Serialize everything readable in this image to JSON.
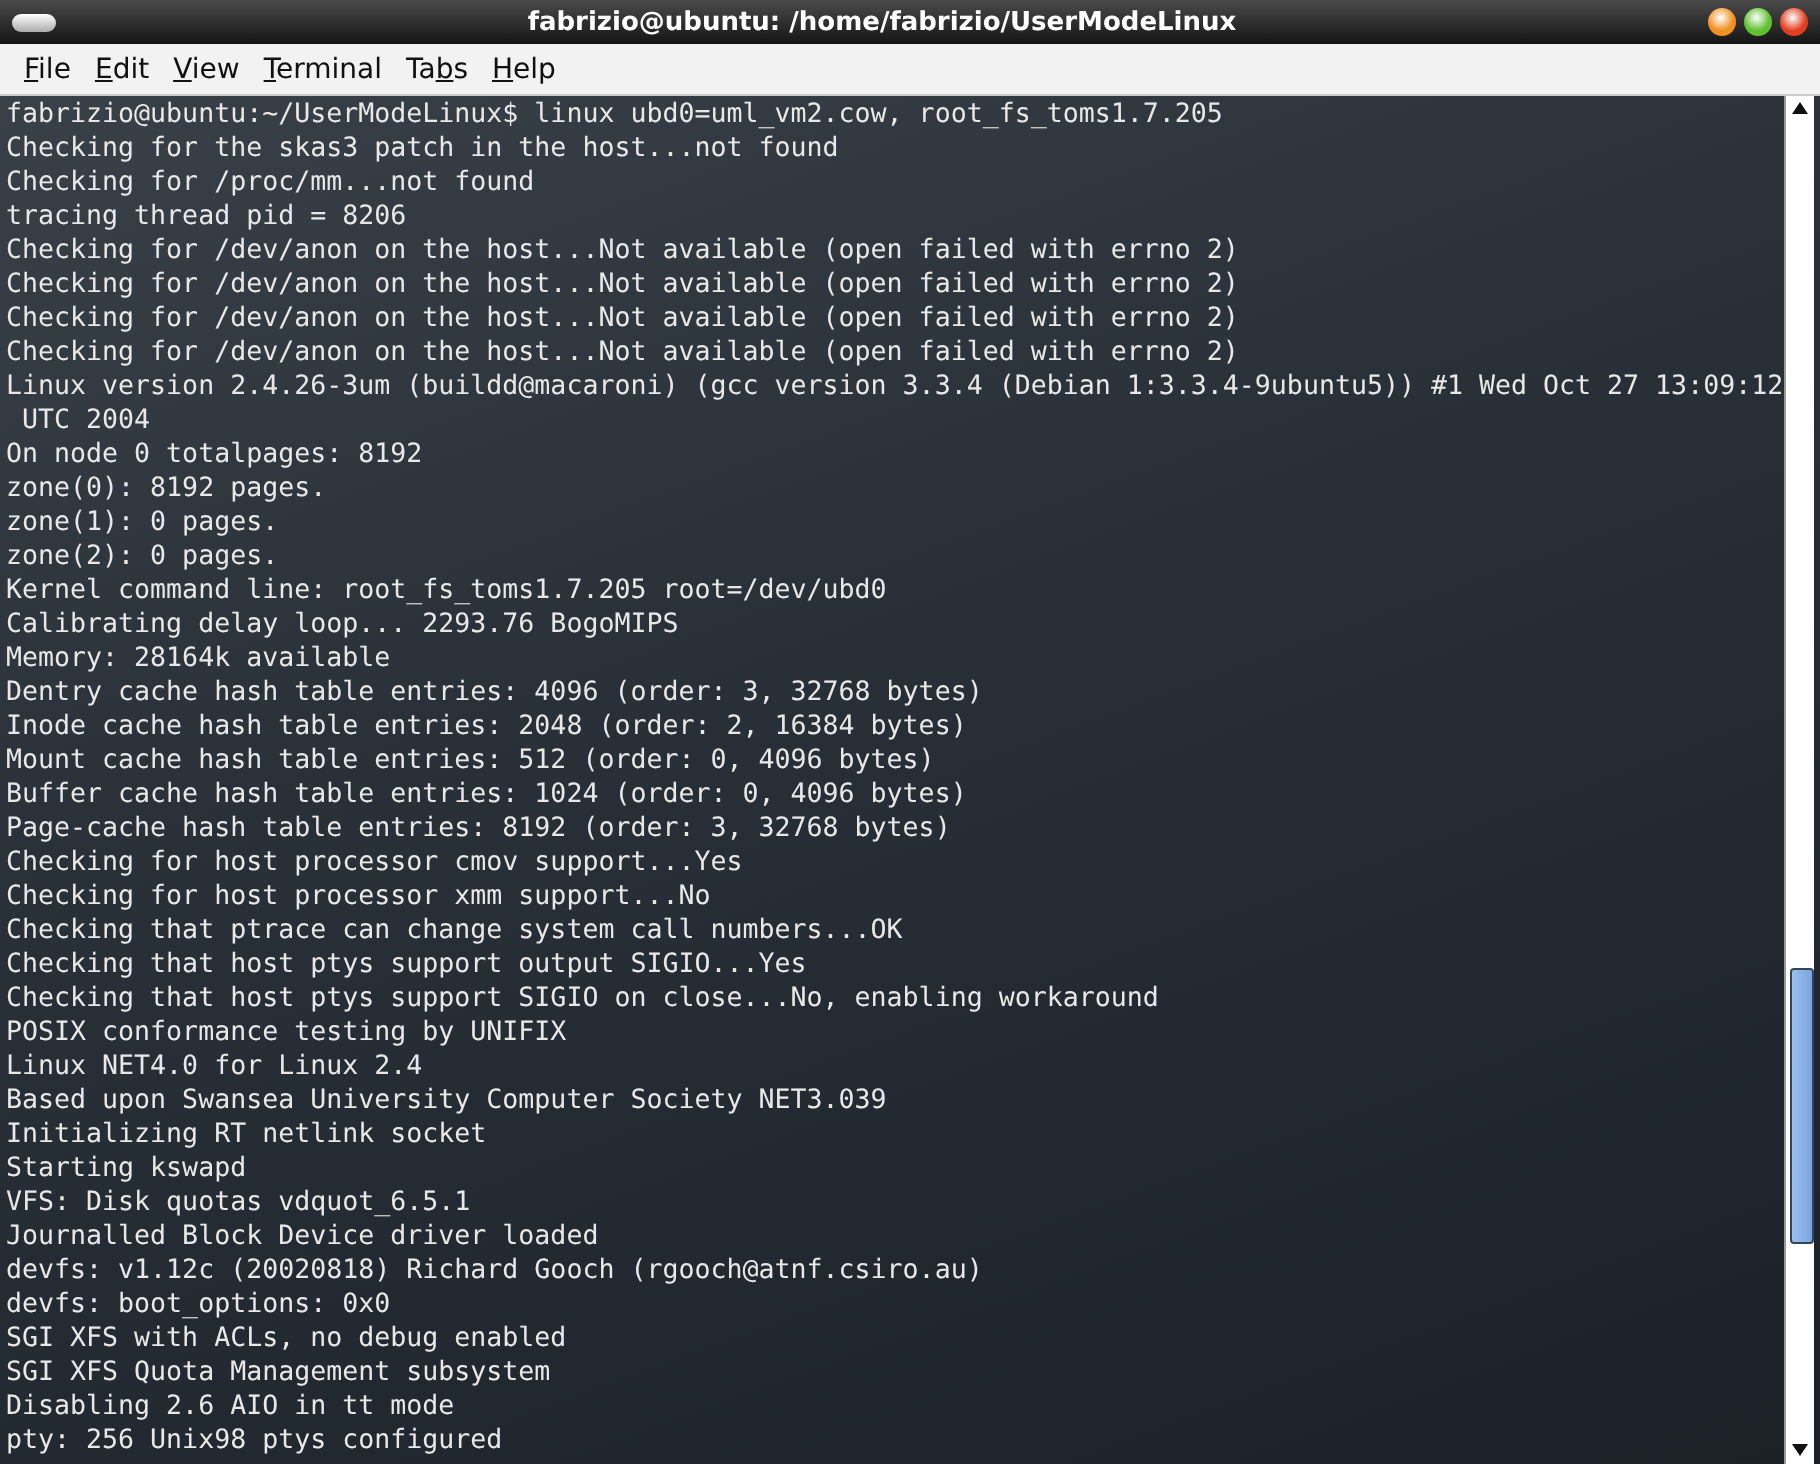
{
  "window": {
    "title": "fabrizio@ubuntu: /home/fabrizio/UserModeLinux"
  },
  "menu": [
    {
      "underlined": "F",
      "rest": "ile"
    },
    {
      "underlined": "E",
      "rest": "dit"
    },
    {
      "underlined": "V",
      "rest": "iew"
    },
    {
      "underlined": "T",
      "rest": "erminal"
    },
    {
      "before": "Ta",
      "underlined": "b",
      "rest": "s"
    },
    {
      "underlined": "H",
      "rest": "elp"
    }
  ],
  "terminal": {
    "lines": [
      "fabrizio@ubuntu:~/UserModeLinux$ linux ubd0=uml_vm2.cow, root_fs_toms1.7.205",
      "Checking for the skas3 patch in the host...not found",
      "Checking for /proc/mm...not found",
      "tracing thread pid = 8206",
      "Checking for /dev/anon on the host...Not available (open failed with errno 2)",
      "Checking for /dev/anon on the host...Not available (open failed with errno 2)",
      "Checking for /dev/anon on the host...Not available (open failed with errno 2)",
      "Checking for /dev/anon on the host...Not available (open failed with errno 2)",
      "Linux version 2.4.26-3um (buildd@macaroni) (gcc version 3.3.4 (Debian 1:3.3.4-9ubuntu5)) #1 Wed Oct 27 13:09:12",
      " UTC 2004",
      "On node 0 totalpages: 8192",
      "zone(0): 8192 pages.",
      "zone(1): 0 pages.",
      "zone(2): 0 pages.",
      "Kernel command line: root_fs_toms1.7.205 root=/dev/ubd0",
      "Calibrating delay loop... 2293.76 BogoMIPS",
      "Memory: 28164k available",
      "Dentry cache hash table entries: 4096 (order: 3, 32768 bytes)",
      "Inode cache hash table entries: 2048 (order: 2, 16384 bytes)",
      "Mount cache hash table entries: 512 (order: 0, 4096 bytes)",
      "Buffer cache hash table entries: 1024 (order: 0, 4096 bytes)",
      "Page-cache hash table entries: 8192 (order: 3, 32768 bytes)",
      "Checking for host processor cmov support...Yes",
      "Checking for host processor xmm support...No",
      "Checking that ptrace can change system call numbers...OK",
      "Checking that host ptys support output SIGIO...Yes",
      "Checking that host ptys support SIGIO on close...No, enabling workaround",
      "POSIX conformance testing by UNIFIX",
      "Linux NET4.0 for Linux 2.4",
      "Based upon Swansea University Computer Society NET3.039",
      "Initializing RT netlink socket",
      "Starting kswapd",
      "VFS: Disk quotas vdquot_6.5.1",
      "Journalled Block Device driver loaded",
      "devfs: v1.12c (20020818) Richard Gooch (rgooch@atnf.csiro.au)",
      "devfs: boot_options: 0x0",
      "SGI XFS with ACLs, no debug enabled",
      "SGI XFS Quota Management subsystem",
      "Disabling 2.6 AIO in tt mode",
      "pty: 256 Unix98 ptys configured"
    ]
  }
}
